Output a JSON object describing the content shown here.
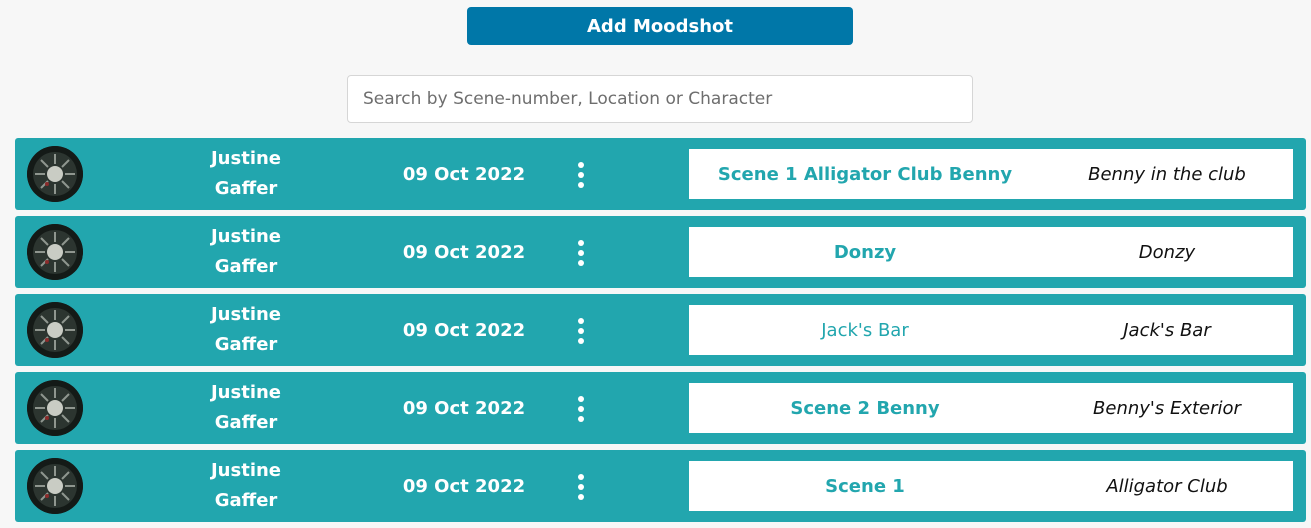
{
  "toolbar": {
    "add_label": "Add Moodshot",
    "accent_color": "#0077a8"
  },
  "search": {
    "placeholder": "Search by Scene-number, Location or Character",
    "value": ""
  },
  "rows": [
    {
      "author_first": "Justine",
      "author_role": "Gaffer",
      "date": "09 Oct 2022",
      "scene": "Scene 1 Alligator Club Benny",
      "description": "Benny in the club"
    },
    {
      "author_first": "Justine",
      "author_role": "Gaffer",
      "date": "09 Oct 2022",
      "scene": "Donzy",
      "description": "Donzy"
    },
    {
      "author_first": "Justine",
      "author_role": "Gaffer",
      "date": "09 Oct 2022",
      "scene": "Jack's Bar",
      "description": "Jack's Bar"
    },
    {
      "author_first": "Justine",
      "author_role": "Gaffer",
      "date": "09 Oct 2022",
      "scene": "Scene 2 Benny",
      "description": "Benny's Exterior"
    },
    {
      "author_first": "Justine",
      "author_role": "Gaffer",
      "date": "09 Oct 2022",
      "scene": "Scene 1",
      "description": "Alligator Club"
    }
  ],
  "icons": {
    "row_menu": "more-vertical-icon",
    "avatar": "avatar-image"
  },
  "colors": {
    "row_background": "#22a6ae",
    "page_background": "#f7f7f7"
  }
}
